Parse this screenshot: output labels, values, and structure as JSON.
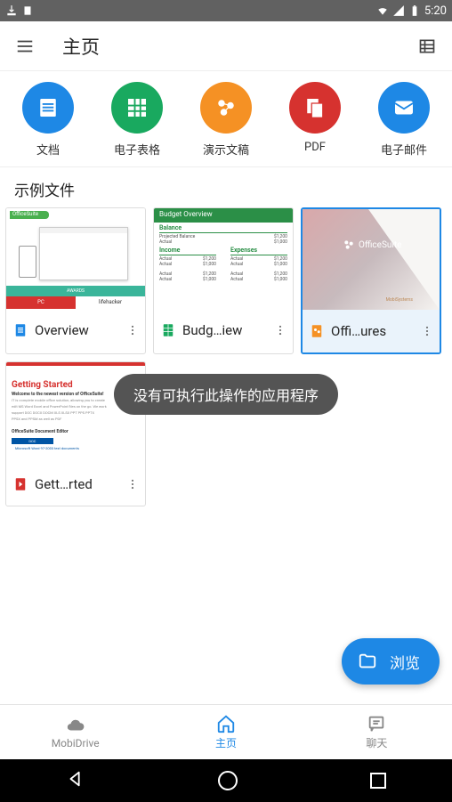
{
  "status": {
    "time": "5:20"
  },
  "appbar": {
    "title": "主页"
  },
  "categories": [
    {
      "label": "文档",
      "color": "#1e88e5",
      "icon": "doc"
    },
    {
      "label": "电子表格",
      "color": "#19a95f",
      "icon": "sheet"
    },
    {
      "label": "演示文稿",
      "color": "#f59124",
      "icon": "pres"
    },
    {
      "label": "PDF",
      "color": "#d6322f",
      "icon": "pdf"
    },
    {
      "label": "电子邮件",
      "color": "#1e88e5",
      "icon": "mail"
    }
  ],
  "section": {
    "title": "示例文件"
  },
  "cards": [
    {
      "title": "Overview",
      "icon": "doc",
      "icon_color": "#1e88e5",
      "selected": false,
      "thumb": {
        "tag": "OfficeSuite",
        "band": "AWARDS",
        "b1": "PC",
        "b2": "lifehacker"
      }
    },
    {
      "title": "Budg…iew",
      "icon": "sheet",
      "icon_color": "#19a95f",
      "selected": false,
      "thumb": {
        "header": "Budget Overview",
        "s1": "Balance",
        "s2": "Income",
        "s3": "Expenses",
        "r1": "Projected Balance",
        "r2": "Actual",
        "v1": "$1,200",
        "v2": "$1,000"
      }
    },
    {
      "title": "Offi…ures",
      "icon": "pres",
      "icon_color": "#f59124",
      "selected": true,
      "thumb": {
        "logo": "OfficeSuite",
        "mark": "MobiSystems"
      }
    },
    {
      "title": "Gett…rted",
      "icon": "pdf",
      "icon_color": "#d6322f",
      "selected": false,
      "thumb": {
        "title": "Getting Started",
        "sub": "Welcome to the newest version of OfficeSuite!",
        "txt1": "IT is complete mobile office solution, allowing you to create",
        "txt2": "edit MS Word Excel and PowerPoint files on the go. We work",
        "txt3": "support DOC DOCX DOCM XLS XLSX PPT PPS PPTX",
        "txt4": "PPSX and PPSM as well as PDF",
        "band": "DOC",
        "line": "Microsoft Word 97-2003 text documents"
      }
    }
  ],
  "toast": {
    "text": "没有可执行此操作的应用程序"
  },
  "fab": {
    "label": "浏览"
  },
  "bottomTabs": [
    {
      "label": "MobiDrive",
      "icon": "cloud",
      "active": false
    },
    {
      "label": "主页",
      "icon": "home",
      "active": true
    },
    {
      "label": "聊天",
      "icon": "chat",
      "active": false
    }
  ]
}
